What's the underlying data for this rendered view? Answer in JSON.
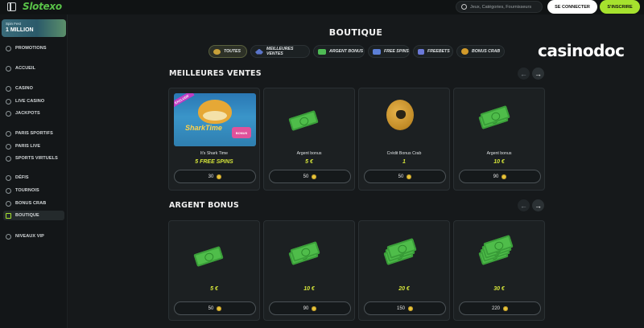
{
  "header": {
    "logo": "Slotexo",
    "search_placeholder": "Jeux, Catégories, Fournisseurs",
    "login_label": "SE CONNECTER",
    "signup_label": "S'INSCRIRE"
  },
  "sidebar": {
    "banner": {
      "line1": "Spin Fest",
      "line2": "1 MILLION"
    },
    "items": [
      {
        "label": "PROMOTIONS",
        "icon": "gift-icon"
      },
      {
        "label": "ACCUEIL",
        "icon": "home-icon"
      },
      {
        "label": "CASINO",
        "icon": "slot-icon"
      },
      {
        "label": "LIVE CASINO",
        "icon": "live-icon"
      },
      {
        "label": "JACKPOTS",
        "icon": "jackpot-icon"
      },
      {
        "label": "PARIS SPORTIFS",
        "icon": "ball-icon"
      },
      {
        "label": "PARIS LIVE",
        "icon": "live-bet-icon"
      },
      {
        "label": "SPORTS VIRTUELS",
        "icon": "virtual-icon"
      },
      {
        "label": "DÉFIS",
        "icon": "target-icon"
      },
      {
        "label": "TOURNOIS",
        "icon": "trophy-icon"
      },
      {
        "label": "BONUS CRAB",
        "icon": "crab-icon"
      },
      {
        "label": "BOUTIQUE",
        "icon": "shop-icon"
      },
      {
        "label": "NIVEAUX VIP",
        "icon": "vip-icon"
      }
    ]
  },
  "page": {
    "title": "BOUTIQUE",
    "watermark": "casinodoc",
    "categories": [
      {
        "label": "TOUTES",
        "active": true
      },
      {
        "label": "MEILLEURES VENTES"
      },
      {
        "label": "ARGENT BONUS"
      },
      {
        "label": "FREE SPINS"
      },
      {
        "label": "FREEBETS"
      },
      {
        "label": "BONUS CRAB"
      }
    ]
  },
  "sections": {
    "best": {
      "title": "MEILLEURES VENTES",
      "cards": [
        {
          "name": "It's Shark Time",
          "value": "5 FREE SPINS",
          "price": "30",
          "badge": "EXCLUSIF",
          "game_logo": "SharkTime",
          "game_badge": "BONUS"
        },
        {
          "name": "Argent bonus",
          "value": "5 €",
          "price": "50"
        },
        {
          "name": "Crédit Bonus Crab",
          "value": "1",
          "price": "50"
        },
        {
          "name": "Argent bonus",
          "value": "10 €",
          "price": "90"
        }
      ]
    },
    "cash": {
      "title": "ARGENT BONUS",
      "cards": [
        {
          "value": "5 €",
          "price": "50"
        },
        {
          "value": "10 €",
          "price": "90"
        },
        {
          "value": "20 €",
          "price": "150"
        },
        {
          "value": "30 €",
          "price": "220"
        }
      ]
    }
  }
}
